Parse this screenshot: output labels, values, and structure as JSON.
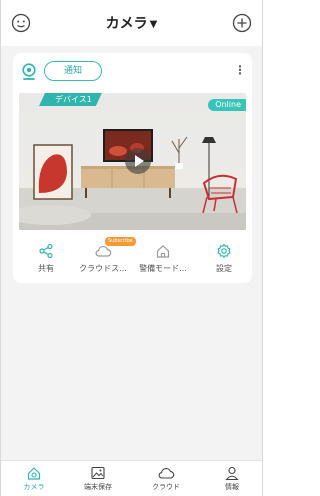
{
  "header": {
    "title": "カメラ",
    "left_icon": "face-scan-icon",
    "right_icon": "add-icon"
  },
  "device_card": {
    "notice_label": "通知",
    "more_label": "⋮",
    "device_name": "デバイス1",
    "status": "Online",
    "actions": [
      {
        "label": "共有",
        "icon": "share-icon"
      },
      {
        "label": "クラウドス...",
        "icon": "cloud-icon",
        "badge": "Subscribe"
      },
      {
        "label": "警備モード...",
        "icon": "home-icon"
      },
      {
        "label": "設定",
        "icon": "gear-icon"
      }
    ]
  },
  "bottom_nav": [
    {
      "label": "カメラ",
      "icon": "camera-nav-icon",
      "active": true
    },
    {
      "label": "端末保存",
      "icon": "image-icon",
      "active": false
    },
    {
      "label": "クラウド",
      "icon": "cloud-nav-icon",
      "active": false
    },
    {
      "label": "情報",
      "icon": "person-icon",
      "active": false
    }
  ],
  "colors": {
    "accent": "#2fb5ad",
    "badge_orange": "#f39a34",
    "background": "#f3f3f3"
  }
}
